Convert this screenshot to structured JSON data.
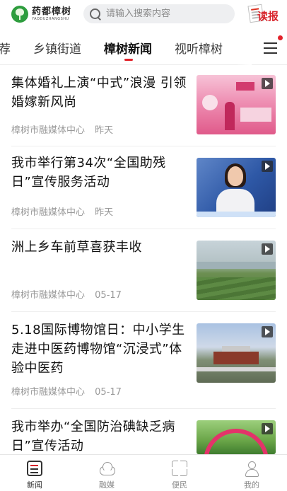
{
  "header": {
    "logo_text": "药都樟树",
    "logo_subtext": "YAODUZHANGSHU",
    "search_placeholder": "请输入搜索内容",
    "read_paper_label": "读报"
  },
  "tabs": [
    {
      "label": "荐",
      "active": false
    },
    {
      "label": "乡镇街道",
      "active": false
    },
    {
      "label": "樟树新闻",
      "active": true
    },
    {
      "label": "视听樟树",
      "active": false
    }
  ],
  "news": [
    {
      "title": "集体婚礼上演“中式”浪漫  引领婚嫁新风尚",
      "source": "樟树市融媒体中心",
      "time": "昨天"
    },
    {
      "title": "我市举行第34次“全国助残日”宣传服务活动",
      "source": "樟树市融媒体中心",
      "time": "昨天"
    },
    {
      "title": "洲上乡车前草喜获丰收",
      "source": "樟树市融媒体中心",
      "time": "05-17"
    },
    {
      "title": "5.18国际博物馆日：中小学生走进中医药博物馆“沉浸式”体验中医药",
      "source": "樟树市融媒体中心",
      "time": "05-17"
    },
    {
      "title": "我市举办“全国防治碘缺乏病日”宣传活动",
      "source": "",
      "time": ""
    }
  ],
  "bottom_nav": [
    {
      "label": "新闻",
      "icon": "news-icon",
      "active": true
    },
    {
      "label": "融媒",
      "icon": "cloud-icon",
      "active": false
    },
    {
      "label": "便民",
      "icon": "grid-icon",
      "active": false
    },
    {
      "label": "我的",
      "icon": "user-icon",
      "active": false
    }
  ],
  "colors": {
    "accent": "#e2222a",
    "brand_green": "#2e9d3e",
    "meta_text": "#999999"
  }
}
